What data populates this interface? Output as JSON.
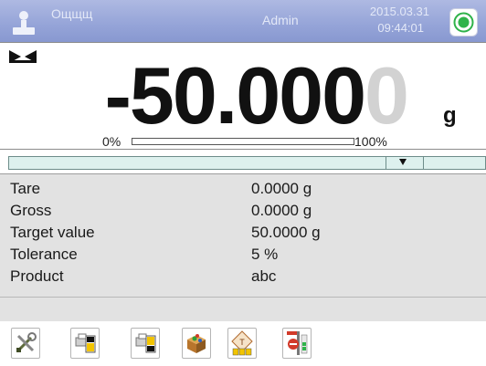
{
  "header": {
    "user_name": "Ощщщ",
    "user_sub": "",
    "mode": "Admin",
    "date": "2015.03.31",
    "time": "09:44:01",
    "status_color": "#2fb34a"
  },
  "weighing": {
    "value_main": "-50.000",
    "value_ghost": "0",
    "unit": "g",
    "bar_min_label": "0%",
    "bar_max_label": "100%",
    "bar_fill_fraction": 0.0
  },
  "info": {
    "rows": [
      {
        "label": "Tare",
        "value": "0.0000 g"
      },
      {
        "label": "Gross",
        "value": "0.0000 g"
      },
      {
        "label": "Target value",
        "value": "50.0000 g"
      },
      {
        "label": "Tolerance",
        "value": "5 %"
      },
      {
        "label": "Product",
        "value": "abc"
      }
    ]
  },
  "toolbar": {
    "buttons": [
      {
        "icon": "tools-icon"
      },
      {
        "icon": "printer-header-icon"
      },
      {
        "icon": "printer-footer-icon"
      },
      {
        "icon": "product-box-icon"
      },
      {
        "icon": "target-abc-icon"
      },
      {
        "icon": "stop-indicator-icon"
      }
    ]
  }
}
